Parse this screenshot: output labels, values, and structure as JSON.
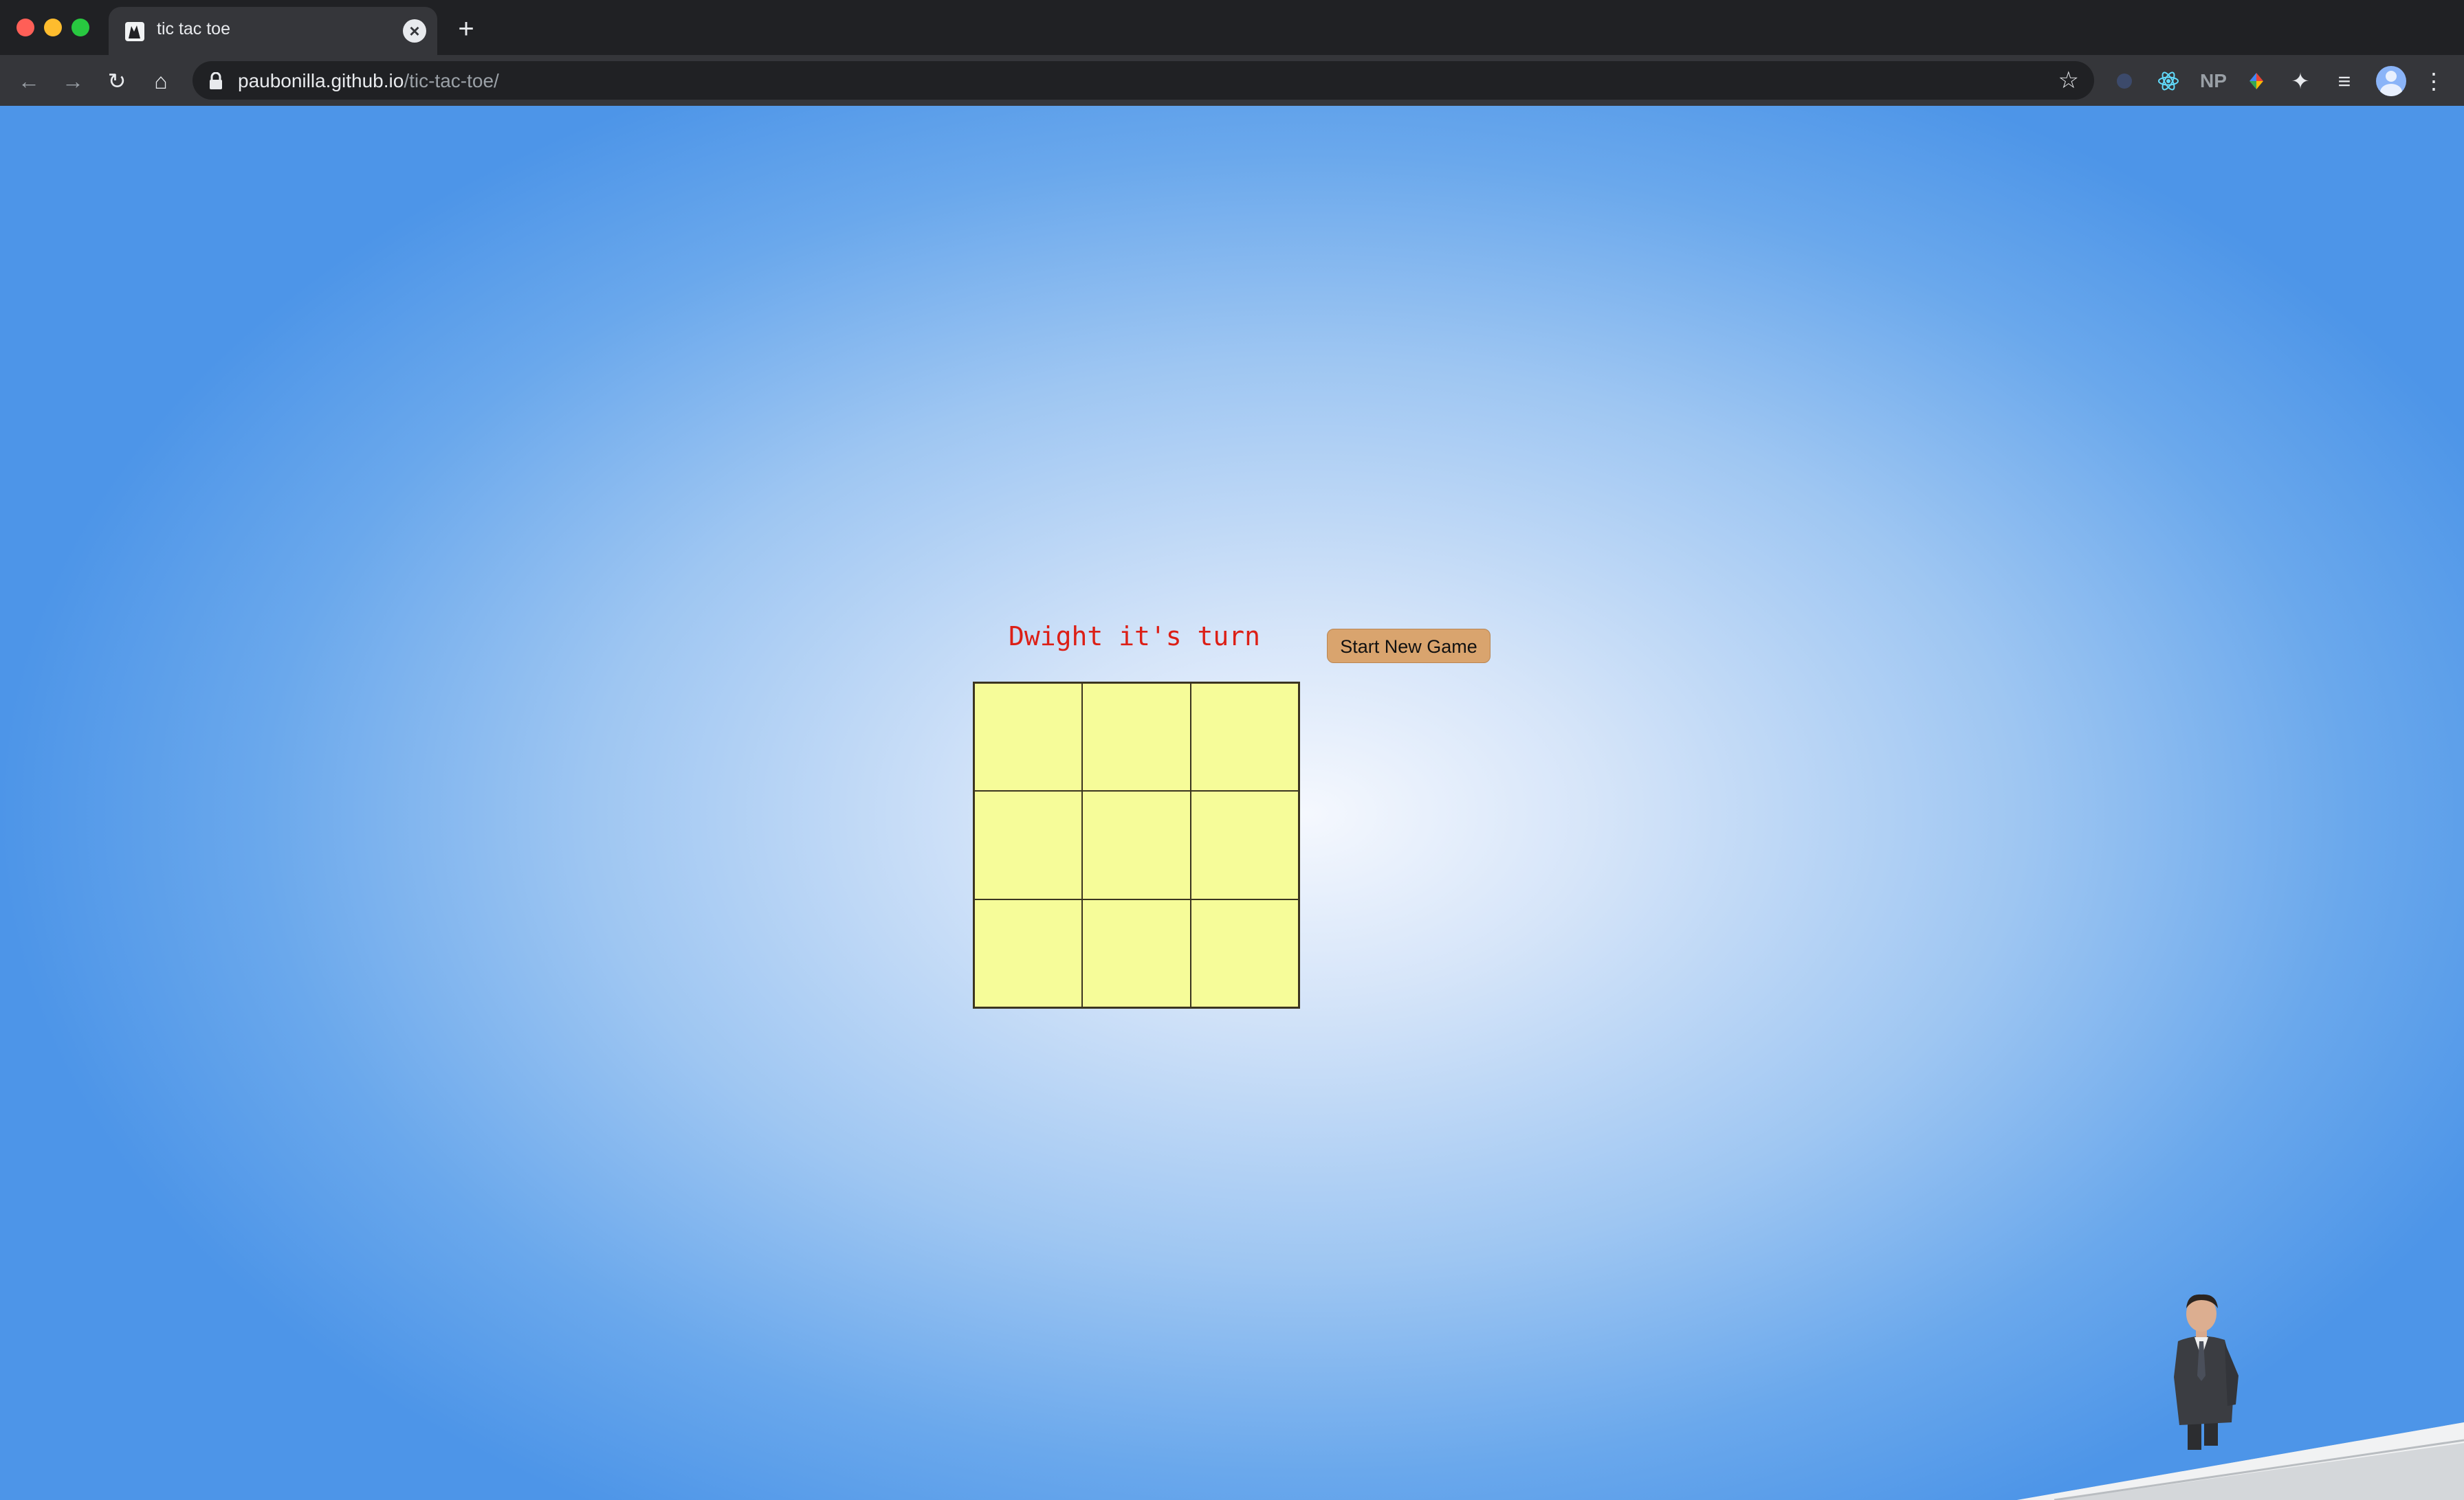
{
  "browser": {
    "tab": {
      "title": "tic tac toe",
      "close_icon": "×",
      "new_tab_icon": "+"
    },
    "address": {
      "host": "paubonilla.github.io",
      "path": "/tic-tac-toe/"
    },
    "nav": {
      "back": "←",
      "forward": "→",
      "reload": "↻",
      "home": "⌂"
    },
    "star_icon": "☆",
    "extensions": {
      "np_label": "NP",
      "puzzle": "✦",
      "media": "≡"
    },
    "menu_icon": "⋮"
  },
  "game": {
    "status": "Dwight it's turn",
    "new_game_label": "Start New Game",
    "board": [
      "",
      "",
      "",
      "",
      "",
      "",
      "",
      "",
      ""
    ]
  },
  "colors": {
    "status_text": "#dc1f16",
    "cell_fill": "#f6fc99",
    "button_fill": "#d9a46e",
    "background_center": "#f5f8fe",
    "background_edge": "#4d95e8"
  }
}
